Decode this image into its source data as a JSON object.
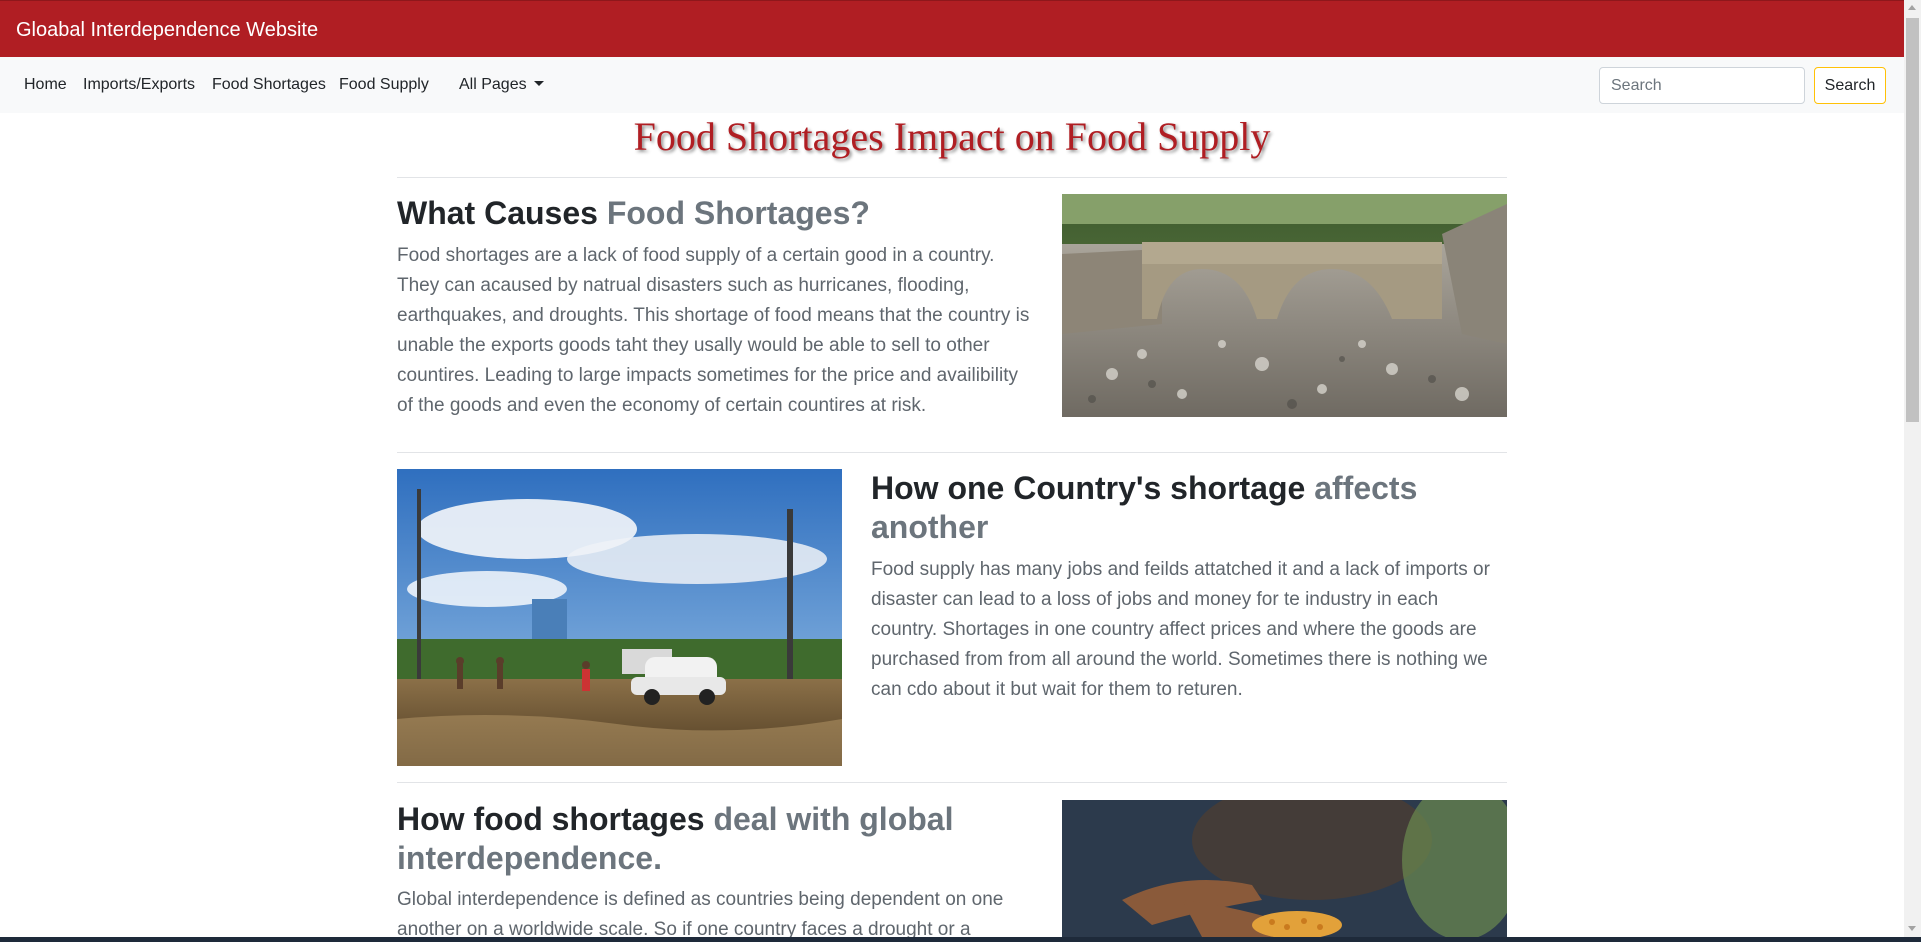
{
  "brand": {
    "title": "Gloabal Interdependence Website",
    "color": "#b01e23"
  },
  "nav": {
    "links": [
      "Home",
      "Imports/Exports",
      "Food Shortages",
      "Food Supply"
    ],
    "dropdown_label": "All Pages",
    "search_placeholder": "Search",
    "search_button": "Search"
  },
  "main": {
    "title": "Food Shortages Impact on Food Supply",
    "sections": [
      {
        "heading_dark": "What Causes ",
        "heading_muted": "Food Shortages?",
        "text": "Food shortages are a lack of food supply of a certain good in a country. They can acaused by natrual disasters such as hurricanes, flooding, earthquakes, and droughts. This shortage of food means that the country is unable the exports goods taht they usally would be able to sell to other countires. Leading to large impacts sometimes for the price and availibility of the goods and even the economy of certain countires at risk.",
        "image": "dry-riverbed-bridge-photo"
      },
      {
        "heading_dark": "How one Country's shortage ",
        "heading_muted": "affects another",
        "text": "Food supply has many jobs and feilds attatched it and a lack of imports or disaster can lead to a loss of jobs and money for te industry in each country. Shortages in one country affect prices and where the goods are purchased from from all around the world. Sometimes there is nothing we can cdo about it but wait for them to returen.",
        "image": "flooded-street-photo"
      },
      {
        "heading_dark": "How food shortages ",
        "heading_muted": "deal with global interdependence.",
        "text": "Global interdependence is defined as countries being dependent on one another on a worldwide scale. So if one country faces a drought or a",
        "image": "hand-holding-corn-photo"
      }
    ]
  }
}
